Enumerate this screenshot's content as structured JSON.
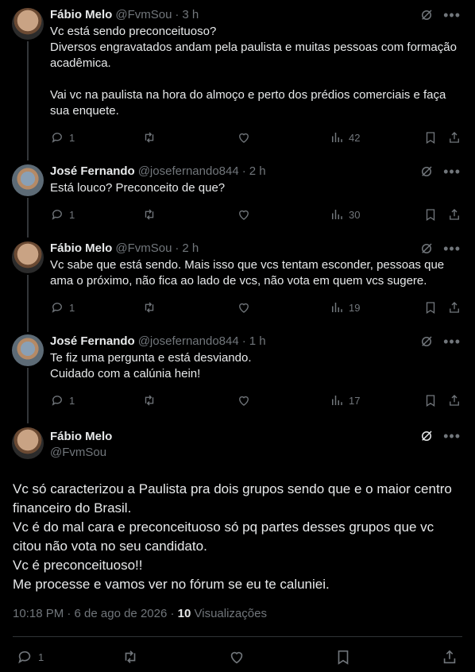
{
  "tweets": [
    {
      "name": "Fábio Melo",
      "handle": "@FvmSou",
      "time": "3 h",
      "text": "Vc está sendo preconceituoso?\nDiversos engravatados andam pela paulista e muitas pessoas com formação acadêmica.\n\nVai vc na paulista na hora do almoço e perto dos prédios comerciais e faça sua enquete.",
      "replies": "1",
      "views": "42"
    },
    {
      "name": "José Fernando",
      "handle": "@josefernando844",
      "time": "2 h",
      "text": "Está louco? Preconceito de que?",
      "replies": "1",
      "views": "30"
    },
    {
      "name": "Fábio Melo",
      "handle": "@FvmSou",
      "time": "2 h",
      "text": "Vc sabe que está sendo. Mais isso que vcs tentam esconder, pessoas que ama o próximo, não fica ao lado de vcs, não vota em quem vcs sugere.",
      "replies": "1",
      "views": "19"
    },
    {
      "name": "José Fernando",
      "handle": "@josefernando844",
      "time": "1 h",
      "text": "Te fiz uma pergunta e está desviando.\nCuidado com a calúnia hein!",
      "replies": "1",
      "views": "17"
    }
  ],
  "main_tweet": {
    "name": "Fábio Melo",
    "handle": "@FvmSou",
    "text": "Vc só caracterizou a Paulista pra dois grupos sendo que e o maior centro financeiro do Brasil.\nVc é do mal cara e preconceituoso só pq partes desses grupos que vc citou não vota no seu candidato.\nVc é preconceituoso!!\nMe processe e vamos ver no fórum se eu te caluniei.",
    "timestamp": "10:18 PM · 6 de ago de 2026 ·",
    "views_count": "10",
    "views_label": "Visualizações",
    "replies": "1"
  },
  "separator": "·",
  "icons": [
    "reply-icon",
    "retweet-icon",
    "like-icon",
    "views-icon",
    "bookmark-icon",
    "share-icon",
    "grok-icon",
    "more-icon"
  ],
  "colors": {
    "background": "#000000",
    "text": "#e7e9ea",
    "muted": "#71767b",
    "divider": "#2f3336"
  }
}
